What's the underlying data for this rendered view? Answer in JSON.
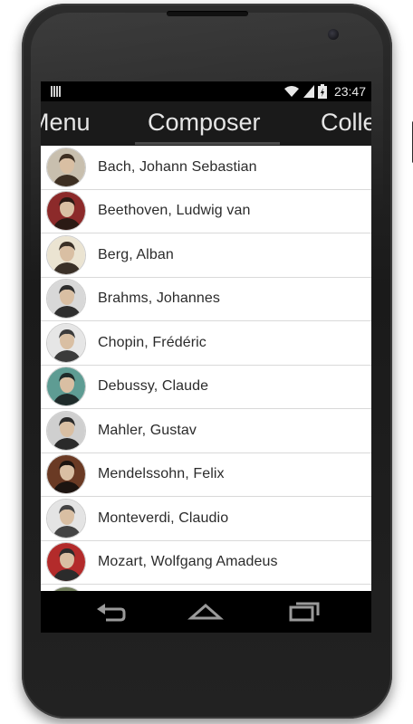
{
  "status_bar": {
    "time": "23:47"
  },
  "tabs": {
    "left": "Menu",
    "center": "Composer",
    "right": "Colle"
  },
  "composers": [
    {
      "name": "Bach, Johann Sebastian",
      "avatar_colors": [
        "#c8bfae",
        "#3d2f22"
      ]
    },
    {
      "name": "Beethoven, Ludwig van",
      "avatar_colors": [
        "#8c2a2a",
        "#2b1a14"
      ]
    },
    {
      "name": "Berg, Alban",
      "avatar_colors": [
        "#ebe4d2",
        "#3a3027"
      ]
    },
    {
      "name": "Brahms, Johannes",
      "avatar_colors": [
        "#d8d8d8",
        "#2e2e2e"
      ]
    },
    {
      "name": "Chopin, Frédéric",
      "avatar_colors": [
        "#e6e6e6",
        "#3b3b3b"
      ]
    },
    {
      "name": "Debussy, Claude",
      "avatar_colors": [
        "#5e9c93",
        "#1f2b2a"
      ]
    },
    {
      "name": "Mahler, Gustav",
      "avatar_colors": [
        "#cfcfcf",
        "#2a2a2a"
      ]
    },
    {
      "name": "Mendelssohn, Felix",
      "avatar_colors": [
        "#6a3a24",
        "#1c1410"
      ]
    },
    {
      "name": "Monteverdi, Claudio",
      "avatar_colors": [
        "#e4e4e4",
        "#444444"
      ]
    },
    {
      "name": "Mozart, Wolfgang Amadeus",
      "avatar_colors": [
        "#b32b2b",
        "#2b2b2b"
      ]
    }
  ],
  "navbar": {
    "icons": [
      "back-icon",
      "home-icon",
      "recents-icon"
    ]
  },
  "colors": {
    "screen_bg": "#ffffff",
    "tab_bar": "#1a1a1a",
    "divider": "#d9d9d9",
    "text": "#2b2b2b"
  }
}
